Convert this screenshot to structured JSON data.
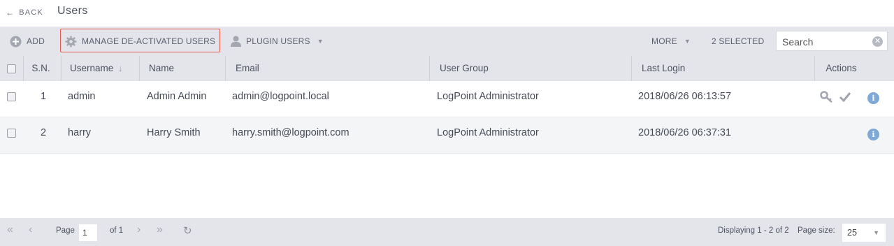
{
  "header": {
    "back_label": "BACK",
    "title": "Users"
  },
  "toolbar": {
    "add_label": "ADD",
    "manage_label": "MANAGE DE-ACTIVATED USERS",
    "plugin_label": "PLUGIN USERS",
    "more_label": "MORE",
    "selected_label": "2 SELECTED",
    "search_placeholder": "Search",
    "highlight_color": "#e25c4d"
  },
  "table": {
    "columns": [
      "S.N.",
      "Username",
      "Name",
      "Email",
      "User Group",
      "Last Login",
      "Actions"
    ],
    "rows": [
      {
        "sn": "1",
        "username": "admin",
        "name": "Admin Admin",
        "email": "admin@logpoint.local",
        "group": "LogPoint Administrator",
        "last_login": "2018/06/26 06:13:57",
        "actions": [
          "key-icon",
          "check-icon",
          "info-icon"
        ]
      },
      {
        "sn": "2",
        "username": "harry",
        "name": "Harry Smith",
        "email": "harry.smith@logpoint.com",
        "group": "LogPoint Administrator",
        "last_login": "2018/06/26 06:37:31",
        "actions": [
          "info-icon"
        ]
      }
    ]
  },
  "footer": {
    "page_label": "Page",
    "page_value": "1",
    "of_label": "of 1",
    "displaying": "Displaying 1 - 2 of 2",
    "page_size_label": "Page size:",
    "page_size_value": "25"
  }
}
